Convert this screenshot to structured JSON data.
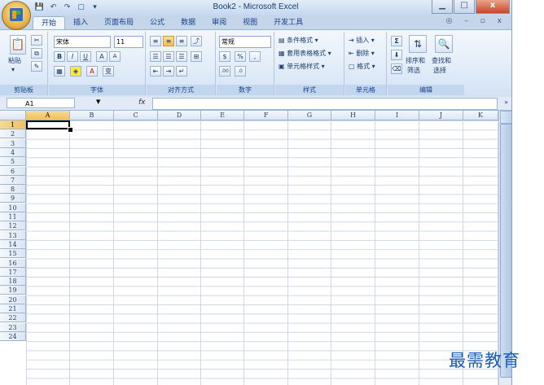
{
  "window": {
    "title": "Book2 - Microsoft Excel"
  },
  "window_controls": {
    "minimize": "▁",
    "restore": "□",
    "close": "x"
  },
  "quick_access": {
    "save": "💾",
    "undo": "↶",
    "redo": "↷",
    "print": "▢",
    "more": "▾"
  },
  "tabs": [
    {
      "label": "开始",
      "active": true
    },
    {
      "label": "插入",
      "active": false
    },
    {
      "label": "页面布局",
      "active": false
    },
    {
      "label": "公式",
      "active": false
    },
    {
      "label": "数据",
      "active": false
    },
    {
      "label": "审阅",
      "active": false
    },
    {
      "label": "视图",
      "active": false
    },
    {
      "label": "开发工具",
      "active": false
    }
  ],
  "tab_right": "◎ – ▫ x",
  "ribbon": {
    "clipboard": {
      "label": "剪贴板",
      "paste": "粘贴"
    },
    "font": {
      "label": "字体",
      "name": "宋体",
      "size": "11",
      "bold": "B",
      "italic": "I",
      "underline": "U",
      "grow": "A",
      "shrink": "A",
      "wen": "变"
    },
    "alignment": {
      "label": "对齐方式"
    },
    "number": {
      "label": "数字",
      "format": "常规",
      "percent": "%",
      "comma": ",",
      "inc": ".00",
      "dec": ".0"
    },
    "styles": {
      "label": "样式",
      "conditional": "条件格式",
      "table": "套用表格格式",
      "cell": "单元格样式"
    },
    "cells": {
      "label": "单元格",
      "insert": "插入",
      "delete": "删除",
      "format": "格式"
    },
    "editing": {
      "label": "编辑",
      "sum": "Σ",
      "sort": "排序和",
      "sort2": "筛选",
      "find": "查找和",
      "find2": "选择"
    }
  },
  "formula_bar": {
    "name_box": "A1",
    "fx": "fx",
    "value": ""
  },
  "columns": [
    "A",
    "B",
    "C",
    "D",
    "E",
    "F",
    "G",
    "H",
    "I",
    "J",
    "K"
  ],
  "rows": [
    "1",
    "2",
    "3",
    "4",
    "5",
    "6",
    "7",
    "8",
    "9",
    "10",
    "11",
    "12",
    "13",
    "14",
    "15",
    "16",
    "17",
    "18",
    "19",
    "20",
    "21",
    "22",
    "23",
    "24"
  ],
  "selected_cell": "A1",
  "watermark": "最需教育"
}
